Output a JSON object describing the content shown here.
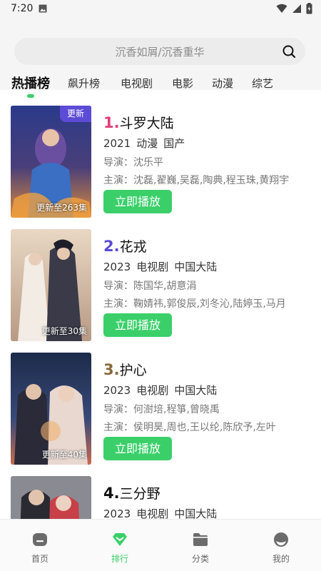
{
  "status_bar": {
    "time": "7:20"
  },
  "search": {
    "placeholder": "沉香如屑/沉香重华",
    "icon": "search-icon"
  },
  "tabs": [
    {
      "label": "热播榜",
      "active": true
    },
    {
      "label": "飙升榜",
      "active": false
    },
    {
      "label": "电视剧",
      "active": false
    },
    {
      "label": "电影",
      "active": false
    },
    {
      "label": "动漫",
      "active": false
    },
    {
      "label": "综艺",
      "active": false
    }
  ],
  "colors": {
    "accent": "#3bcf6a",
    "badge": "#5b4bd6",
    "rank1": "#e0407a",
    "rank2": "#5b4bd6",
    "rank3": "#8a6a3c",
    "rank4": "#111111"
  },
  "items": [
    {
      "rank": "1.",
      "title": "斗罗大陆",
      "year": "2021",
      "type": "动漫",
      "region": "国产",
      "director": "导演：沈乐平",
      "cast": "主演：沈磊,翟巍,吴磊,陶典,程玉珠,黄翔宇",
      "update": "更新至263集",
      "badge": "更新",
      "play": "立即播放"
    },
    {
      "rank": "2.",
      "title": "花戎",
      "year": "2023",
      "type": "电视剧",
      "region": "中国大陆",
      "director": "导演：陈国华,胡意涓",
      "cast": "主演：鞠婧祎,郭俊辰,刘冬沁,陆婷玉,马月",
      "update": "更新至30集",
      "badge": "",
      "play": "立即播放"
    },
    {
      "rank": "3.",
      "title": "护心",
      "year": "2023",
      "type": "电视剧",
      "region": "中国大陆",
      "director": "导演：何澍培,程箏,曾晓禹",
      "cast": "主演：侯明昊,周也,王以纶,陈欣予,左叶",
      "update": "更新至40集",
      "badge": "",
      "play": "立即播放"
    },
    {
      "rank": "4.",
      "title": "三分野",
      "year": "2023",
      "type": "电视剧",
      "region": "中国大陆",
      "director": "",
      "cast": "",
      "update": "",
      "badge": "",
      "play": ""
    }
  ],
  "bottom_nav": [
    {
      "label": "首页",
      "icon": "home-icon",
      "active": false
    },
    {
      "label": "排行",
      "icon": "ranking-icon",
      "active": true
    },
    {
      "label": "分类",
      "icon": "folder-icon",
      "active": false
    },
    {
      "label": "我的",
      "icon": "profile-icon",
      "active": false
    }
  ]
}
